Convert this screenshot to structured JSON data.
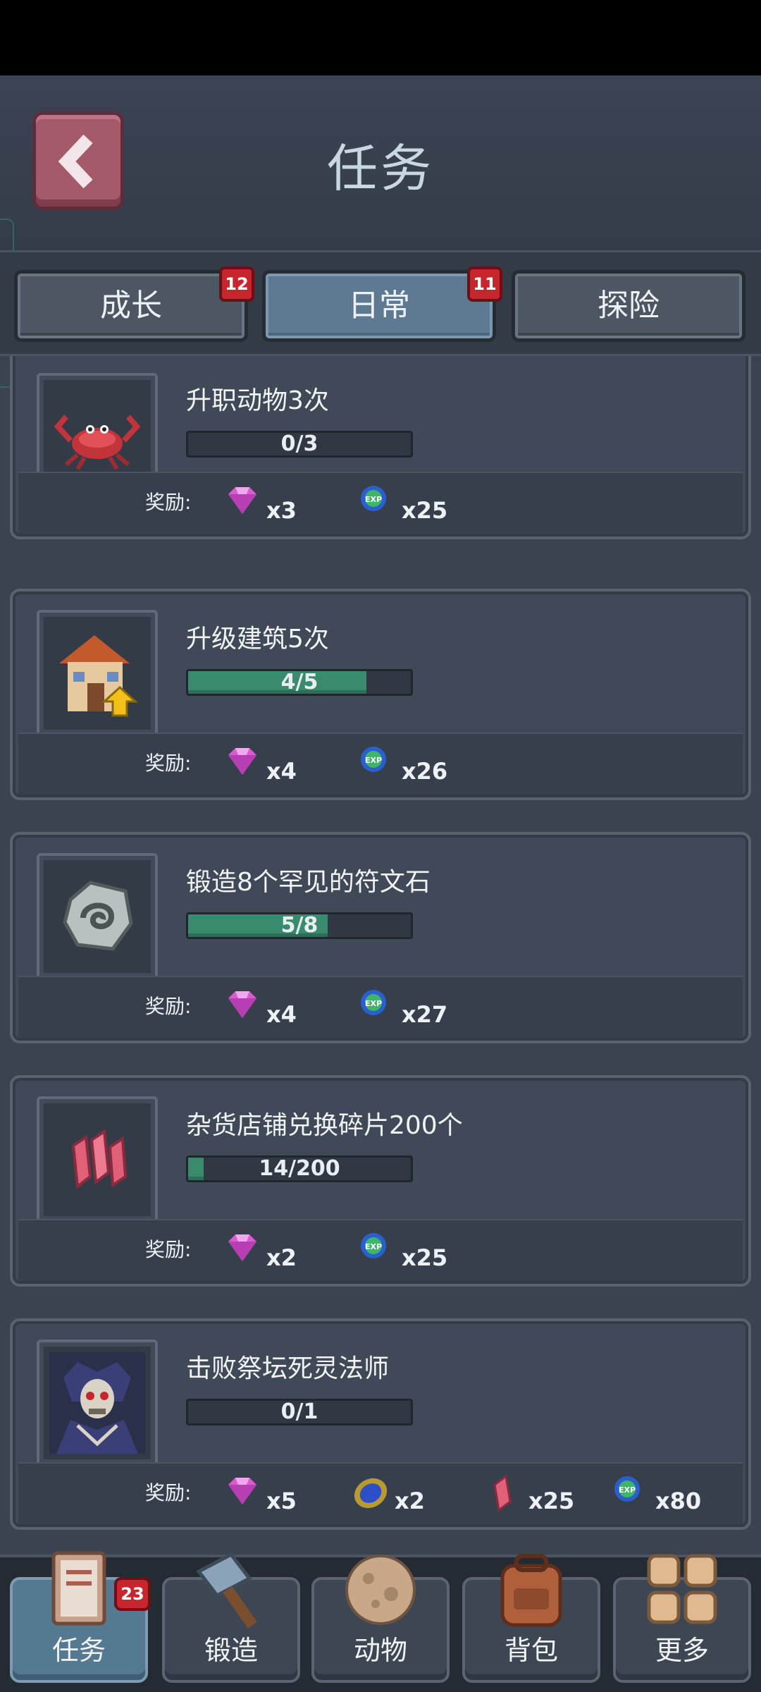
{
  "header": {
    "title": "任务"
  },
  "tabs": [
    {
      "label": "成长",
      "badge": "12",
      "active": false
    },
    {
      "label": "日常",
      "badge": "11",
      "active": true
    },
    {
      "label": "探险",
      "badge": "",
      "active": false
    }
  ],
  "reward_label": "奖励:",
  "tasks": [
    {
      "title": "升职动物3次",
      "icon": "crab-icon",
      "progress_text": "0/3",
      "progress_value": 0,
      "progress_max": 3,
      "rewards": [
        {
          "icon": "gem-icon",
          "count": "x3"
        },
        {
          "icon": "exp-icon",
          "count": "x25"
        }
      ]
    },
    {
      "title": "升级建筑5次",
      "icon": "building-upgrade-icon",
      "progress_text": "4/5",
      "progress_value": 4,
      "progress_max": 5,
      "rewards": [
        {
          "icon": "gem-icon",
          "count": "x4"
        },
        {
          "icon": "exp-icon",
          "count": "x26"
        }
      ]
    },
    {
      "title": "锻造8个罕见的符文石",
      "icon": "rune-stone-icon",
      "progress_text": "5/8",
      "progress_value": 5,
      "progress_max": 8,
      "rewards": [
        {
          "icon": "gem-icon",
          "count": "x4"
        },
        {
          "icon": "exp-icon",
          "count": "x27"
        }
      ]
    },
    {
      "title": "杂货店铺兑换碎片200个",
      "icon": "shards-icon",
      "progress_text": "14/200",
      "progress_value": 14,
      "progress_max": 200,
      "rewards": [
        {
          "icon": "gem-icon",
          "count": "x2"
        },
        {
          "icon": "exp-icon",
          "count": "x25"
        }
      ]
    },
    {
      "title": "击败祭坛死灵法师",
      "icon": "necromancer-icon",
      "progress_text": "0/1",
      "progress_value": 0,
      "progress_max": 1,
      "rewards": [
        {
          "icon": "gem-icon",
          "count": "x5"
        },
        {
          "icon": "sapphire-icon",
          "count": "x2"
        },
        {
          "icon": "shard-icon",
          "count": "x25"
        },
        {
          "icon": "exp-icon",
          "count": "x80"
        }
      ]
    }
  ],
  "nav": [
    {
      "label": "任务",
      "icon": "quest-book-icon",
      "badge": "23",
      "active": true
    },
    {
      "label": "锻造",
      "icon": "hammer-icon",
      "badge": "",
      "active": false
    },
    {
      "label": "动物",
      "icon": "egg-icon",
      "badge": "",
      "active": false
    },
    {
      "label": "背包",
      "icon": "backpack-icon",
      "badge": "",
      "active": false
    },
    {
      "label": "更多",
      "icon": "more-grid-icon",
      "badge": "",
      "active": false
    }
  ],
  "colors": {
    "progress_fill": "#3a8a6e",
    "badge": "#c8262e",
    "active_tab": "#5e7a93"
  }
}
